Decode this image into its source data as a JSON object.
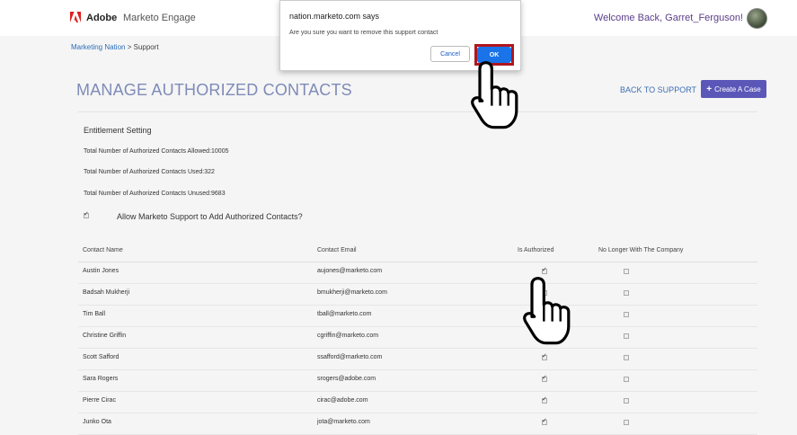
{
  "header": {
    "brand": "Adobe",
    "product": "Marketo Engage",
    "welcome": "Welcome Back, Garret_Ferguson!"
  },
  "breadcrumb": {
    "root": "Marketing Nation",
    "separator": ">",
    "current": "Support"
  },
  "page": {
    "title": "MANAGE AUTHORIZED CONTACTS",
    "back_link": "BACK TO SUPPORT",
    "create_label": "Create A Case"
  },
  "entitlement": {
    "title": "Entitlement Setting",
    "allowed": "Total Number of Authorized Contacts Allowed:10005",
    "used": "Total Number of Authorized Contacts Used:322",
    "unused": "Total Number of Authorized Contacts Unused:9683",
    "allow_support_label": "Allow Marketo Support to Add Authorized Contacts?",
    "allow_support_checked": true
  },
  "table": {
    "headers": [
      "Contact Name",
      "Contact Email",
      "Is Authorized",
      "No Longer With The Company"
    ],
    "rows": [
      {
        "name": "Austin Jones",
        "email": "aujones@marketo.com",
        "authorized": true,
        "no_longer": false
      },
      {
        "name": "Badsah Mukherji",
        "email": "bmukherji@marketo.com",
        "authorized": false,
        "no_longer": false
      },
      {
        "name": "Tim Ball",
        "email": "tball@marketo.com",
        "authorized": false,
        "no_longer": false
      },
      {
        "name": "Christine Griffin",
        "email": "cgriffin@marketo.com",
        "authorized": false,
        "no_longer": false
      },
      {
        "name": "Scott Safford",
        "email": "ssafford@marketo.com",
        "authorized": true,
        "no_longer": false
      },
      {
        "name": "Sara Rogers",
        "email": "srogers@adobe.com",
        "authorized": true,
        "no_longer": false
      },
      {
        "name": "Pierre Cirac",
        "email": "cirac@adobe.com",
        "authorized": true,
        "no_longer": false
      },
      {
        "name": "Junko Ota",
        "email": "jota@marketo.com",
        "authorized": true,
        "no_longer": false
      }
    ]
  },
  "dialog": {
    "title": "nation.marketo.com says",
    "message": "Are you sure you want to remove this support contact",
    "cancel_label": "Cancel",
    "ok_label": "OK"
  },
  "colors": {
    "accent": "#5b57b8",
    "title": "#7f8bb8",
    "link": "#3d6fb6",
    "ok_button": "#1a73e8",
    "highlight": "#b0161e"
  },
  "icons": [
    "adobe-logo-icon",
    "plus-icon",
    "hand-pointer-icon"
  ]
}
